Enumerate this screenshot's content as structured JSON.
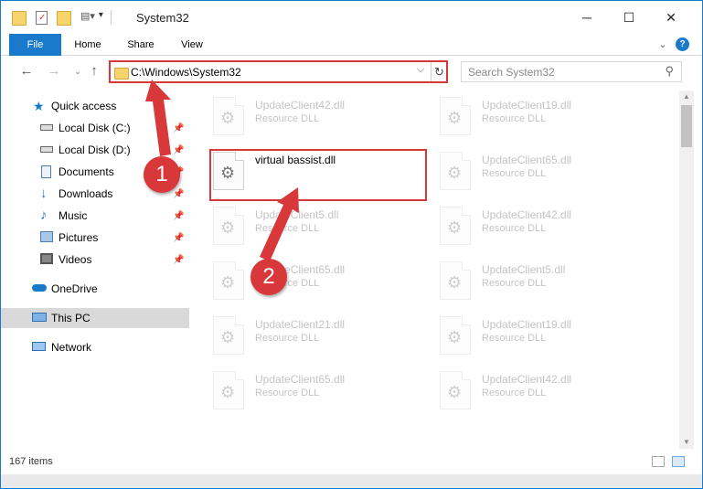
{
  "window": {
    "title": "System32",
    "minimize": "─",
    "maximize": "☐",
    "close": "✕"
  },
  "ribbon": {
    "tabs": [
      "File",
      "Home",
      "Share",
      "View"
    ],
    "help": "?",
    "collapse": "⌄"
  },
  "address": {
    "path": "C:\\Windows\\System32",
    "search_placeholder": "Search System32"
  },
  "nav": {
    "items": [
      {
        "label": "Quick access",
        "icon": "star-icon",
        "color": "#1979ca"
      },
      {
        "label": "Local Disk (C:)",
        "icon": "drive-icon",
        "color": "#6b6b6b"
      },
      {
        "label": "Local Disk (D:)",
        "icon": "drive-icon",
        "color": "#6b6b6b"
      },
      {
        "label": "Documents",
        "icon": "documents-icon",
        "color": "#4a7eb8"
      },
      {
        "label": "Downloads",
        "icon": "downloads-icon",
        "color": "#2f74c0"
      },
      {
        "label": "Music",
        "icon": "music-icon",
        "color": "#2f74c0"
      },
      {
        "label": "Pictures",
        "icon": "pictures-icon",
        "color": "#4a7eb8"
      },
      {
        "label": "Videos",
        "icon": "videos-icon",
        "color": "#555"
      },
      {
        "label": "OneDrive",
        "icon": "onedrive-icon",
        "color": "#1979ca"
      },
      {
        "label": "This PC",
        "icon": "this-pc-icon",
        "color": "#4a8fd4"
      },
      {
        "label": "Network",
        "icon": "network-icon",
        "color": "#3a86c8"
      }
    ]
  },
  "files": {
    "left_column": [
      {
        "name": "UpdateClient42.dll",
        "type": "Resource DLL"
      },
      {
        "name": "virtual bassist.dll",
        "type": ""
      },
      {
        "name": "UpdateClient5.dll",
        "type": "Resource DLL"
      },
      {
        "name": "UpdateClient65.dll",
        "type": "Resource DLL"
      },
      {
        "name": "UpdateClient21.dll",
        "type": "Resource DLL"
      },
      {
        "name": "UpdateClient65.dll",
        "type": "Resource DLL"
      }
    ],
    "right_column": [
      {
        "name": "UpdateClient19.dll",
        "type": "Resource DLL"
      },
      {
        "name": "UpdateClient65.dll",
        "type": "Resource DLL"
      },
      {
        "name": "UpdateClient42.dll",
        "type": "Resource DLL"
      },
      {
        "name": "UpdateClient5.dll",
        "type": "Resource DLL"
      },
      {
        "name": "UpdateClient19.dll",
        "type": "Resource DLL"
      },
      {
        "name": "UpdateClient42.dll",
        "type": "Resource DLL"
      }
    ]
  },
  "status": {
    "item_count": "167 items"
  },
  "callouts": {
    "one": "1",
    "two": "2",
    "color": "#d9383a"
  }
}
